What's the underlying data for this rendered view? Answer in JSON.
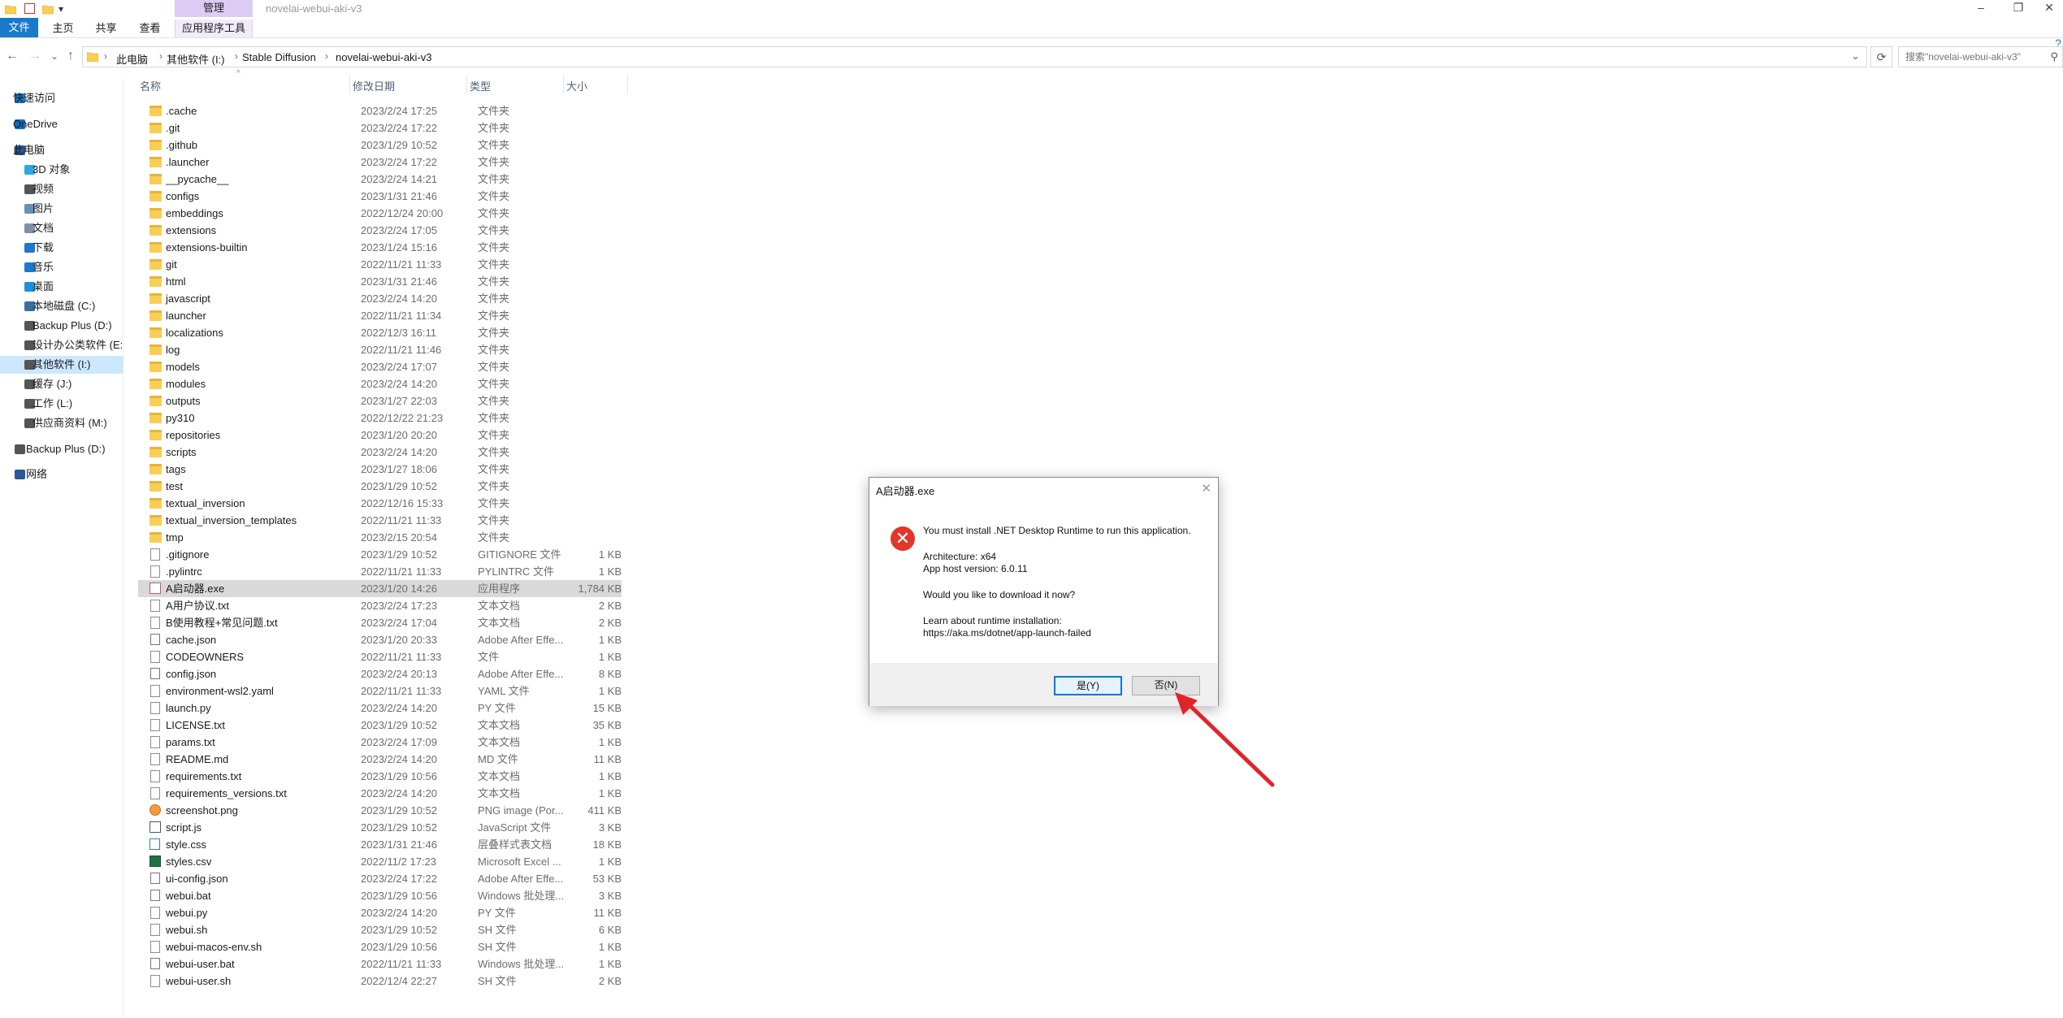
{
  "window": {
    "title": "novelai-webui-aki-v3",
    "context_tab": "管理",
    "controls": [
      "–",
      "❐",
      "✕"
    ]
  },
  "ribbon": {
    "tabs": [
      "文件",
      "主页",
      "共享",
      "查看",
      "应用程序工具"
    ],
    "help_glyph": "?"
  },
  "nav": {
    "back": "←",
    "forward": "→",
    "recent": "⌄",
    "up": "↑",
    "breadcrumb": [
      "此电脑",
      "其他软件 (I:)",
      "Stable Diffusion",
      "novelai-webui-aki-v3"
    ],
    "separator": "›",
    "dropdown": "⌄",
    "refresh": "⟳",
    "search_placeholder": "搜索\"novelai-webui-aki-v3\"",
    "search_glyph": "⚲"
  },
  "sidebar": {
    "items": [
      {
        "label": "快速访问",
        "icon": "star-icon",
        "color": "#1979ca"
      },
      {
        "label": "OneDrive",
        "icon": "cloud-icon",
        "color": "#0f6cbd"
      },
      {
        "label": "此电脑",
        "icon": "computer-icon",
        "color": "#2b5797"
      },
      {
        "label": "3D 对象",
        "icon": "cube-icon",
        "color": "#2ea8e0"
      },
      {
        "label": "视频",
        "icon": "video-icon",
        "color": "#555555"
      },
      {
        "label": "图片",
        "icon": "picture-icon",
        "color": "#6a8fb5"
      },
      {
        "label": "文档",
        "icon": "document-icon",
        "color": "#7f8fa6"
      },
      {
        "label": "下载",
        "icon": "download-icon",
        "color": "#1979ca"
      },
      {
        "label": "音乐",
        "icon": "music-icon",
        "color": "#1979ca"
      },
      {
        "label": "桌面",
        "icon": "desktop-icon",
        "color": "#1d8fe0"
      },
      {
        "label": "本地磁盘 (C:)",
        "icon": "windows-drive-icon",
        "color": "#3a6ea5"
      },
      {
        "label": "Backup Plus (D:)",
        "icon": "drive-icon",
        "color": "#555555"
      },
      {
        "label": "设计办公类软件 (E:",
        "icon": "drive-icon",
        "color": "#555555"
      },
      {
        "label": "其他软件 (I:)",
        "icon": "drive-icon",
        "color": "#555555"
      },
      {
        "label": "缓存 (J:)",
        "icon": "drive-icon",
        "color": "#555555"
      },
      {
        "label": "工作 (L:)",
        "icon": "drive-icon",
        "color": "#555555"
      },
      {
        "label": "供应商资料 (M:)",
        "icon": "drive-icon",
        "color": "#555555"
      },
      {
        "label": "Backup Plus (D:)",
        "icon": "drive-icon",
        "color": "#555555"
      },
      {
        "label": "网络",
        "icon": "network-icon",
        "color": "#2b5797"
      }
    ],
    "selected_index": 13
  },
  "columns": {
    "name": "名称",
    "date": "修改日期",
    "type": "类型",
    "size": "大小",
    "sort_glyph": "^"
  },
  "files": [
    {
      "name": ".cache",
      "date": "2023/2/24 17:25",
      "type": "文件夹",
      "size": "",
      "kind": "folder"
    },
    {
      "name": ".git",
      "date": "2023/2/24 17:22",
      "type": "文件夹",
      "size": "",
      "kind": "folder"
    },
    {
      "name": ".github",
      "date": "2023/1/29 10:52",
      "type": "文件夹",
      "size": "",
      "kind": "folder"
    },
    {
      "name": ".launcher",
      "date": "2023/2/24 17:22",
      "type": "文件夹",
      "size": "",
      "kind": "folder"
    },
    {
      "name": "__pycache__",
      "date": "2023/2/24 14:21",
      "type": "文件夹",
      "size": "",
      "kind": "folder"
    },
    {
      "name": "configs",
      "date": "2023/1/31 21:46",
      "type": "文件夹",
      "size": "",
      "kind": "folder"
    },
    {
      "name": "embeddings",
      "date": "2022/12/24 20:00",
      "type": "文件夹",
      "size": "",
      "kind": "folder"
    },
    {
      "name": "extensions",
      "date": "2023/2/24 17:05",
      "type": "文件夹",
      "size": "",
      "kind": "folder"
    },
    {
      "name": "extensions-builtin",
      "date": "2023/1/24 15:16",
      "type": "文件夹",
      "size": "",
      "kind": "folder"
    },
    {
      "name": "git",
      "date": "2022/11/21 11:33",
      "type": "文件夹",
      "size": "",
      "kind": "folder"
    },
    {
      "name": "html",
      "date": "2023/1/31 21:46",
      "type": "文件夹",
      "size": "",
      "kind": "folder"
    },
    {
      "name": "javascript",
      "date": "2023/2/24 14:20",
      "type": "文件夹",
      "size": "",
      "kind": "folder"
    },
    {
      "name": "launcher",
      "date": "2022/11/21 11:34",
      "type": "文件夹",
      "size": "",
      "kind": "folder"
    },
    {
      "name": "localizations",
      "date": "2022/12/3 16:11",
      "type": "文件夹",
      "size": "",
      "kind": "folder"
    },
    {
      "name": "log",
      "date": "2022/11/21 11:46",
      "type": "文件夹",
      "size": "",
      "kind": "folder"
    },
    {
      "name": "models",
      "date": "2023/2/24 17:07",
      "type": "文件夹",
      "size": "",
      "kind": "folder"
    },
    {
      "name": "modules",
      "date": "2023/2/24 14:20",
      "type": "文件夹",
      "size": "",
      "kind": "folder"
    },
    {
      "name": "outputs",
      "date": "2023/1/27 22:03",
      "type": "文件夹",
      "size": "",
      "kind": "folder"
    },
    {
      "name": "py310",
      "date": "2022/12/22 21:23",
      "type": "文件夹",
      "size": "",
      "kind": "folder"
    },
    {
      "name": "repositories",
      "date": "2023/1/20 20:20",
      "type": "文件夹",
      "size": "",
      "kind": "folder"
    },
    {
      "name": "scripts",
      "date": "2023/2/24 14:20",
      "type": "文件夹",
      "size": "",
      "kind": "folder"
    },
    {
      "name": "tags",
      "date": "2023/1/27 18:06",
      "type": "文件夹",
      "size": "",
      "kind": "folder"
    },
    {
      "name": "test",
      "date": "2023/1/29 10:52",
      "type": "文件夹",
      "size": "",
      "kind": "folder"
    },
    {
      "name": "textual_inversion",
      "date": "2022/12/16 15:33",
      "type": "文件夹",
      "size": "",
      "kind": "folder"
    },
    {
      "name": "textual_inversion_templates",
      "date": "2022/11/21 11:33",
      "type": "文件夹",
      "size": "",
      "kind": "folder"
    },
    {
      "name": "tmp",
      "date": "2023/2/15 20:54",
      "type": "文件夹",
      "size": "",
      "kind": "folder"
    },
    {
      "name": ".gitignore",
      "date": "2023/1/29 10:52",
      "type": "GITIGNORE 文件",
      "size": "1 KB",
      "kind": "file"
    },
    {
      "name": ".pylintrc",
      "date": "2022/11/21 11:33",
      "type": "PYLINTRC 文件",
      "size": "1 KB",
      "kind": "file"
    },
    {
      "name": "A启动器.exe",
      "date": "2023/1/20 14:26",
      "type": "应用程序",
      "size": "1,784 KB",
      "kind": "exe"
    },
    {
      "name": "A用户协议.txt",
      "date": "2023/2/24 17:23",
      "type": "文本文档",
      "size": "2 KB",
      "kind": "file"
    },
    {
      "name": "B使用教程+常见问题.txt",
      "date": "2023/2/24 17:04",
      "type": "文本文档",
      "size": "2 KB",
      "kind": "file"
    },
    {
      "name": "cache.json",
      "date": "2023/1/20 20:33",
      "type": "Adobe After Effe...",
      "size": "1 KB",
      "kind": "gear"
    },
    {
      "name": "CODEOWNERS",
      "date": "2022/11/21 11:33",
      "type": "文件",
      "size": "1 KB",
      "kind": "file"
    },
    {
      "name": "config.json",
      "date": "2023/2/24 20:13",
      "type": "Adobe After Effe...",
      "size": "8 KB",
      "kind": "gear"
    },
    {
      "name": "environment-wsl2.yaml",
      "date": "2022/11/21 11:33",
      "type": "YAML 文件",
      "size": "1 KB",
      "kind": "file"
    },
    {
      "name": "launch.py",
      "date": "2023/2/24 14:20",
      "type": "PY 文件",
      "size": "15 KB",
      "kind": "file"
    },
    {
      "name": "LICENSE.txt",
      "date": "2023/1/29 10:52",
      "type": "文本文档",
      "size": "35 KB",
      "kind": "file"
    },
    {
      "name": "params.txt",
      "date": "2023/2/24 17:09",
      "type": "文本文档",
      "size": "1 KB",
      "kind": "file"
    },
    {
      "name": "README.md",
      "date": "2023/2/24 14:20",
      "type": "MD 文件",
      "size": "11 KB",
      "kind": "file"
    },
    {
      "name": "requirements.txt",
      "date": "2023/1/29 10:56",
      "type": "文本文档",
      "size": "1 KB",
      "kind": "file"
    },
    {
      "name": "requirements_versions.txt",
      "date": "2023/2/24 14:20",
      "type": "文本文档",
      "size": "1 KB",
      "kind": "file"
    },
    {
      "name": "screenshot.png",
      "date": "2023/1/29 10:52",
      "type": "PNG image (Por...",
      "size": "411 KB",
      "kind": "img"
    },
    {
      "name": "script.js",
      "date": "2023/1/29 10:52",
      "type": "JavaScript 文件",
      "size": "3 KB",
      "kind": "js"
    },
    {
      "name": "style.css",
      "date": "2023/1/31 21:46",
      "type": "层叠样式表文档",
      "size": "18 KB",
      "kind": "css"
    },
    {
      "name": "styles.csv",
      "date": "2022/11/2 17:23",
      "type": "Microsoft Excel ...",
      "size": "1 KB",
      "kind": "xls"
    },
    {
      "name": "ui-config.json",
      "date": "2023/2/24 17:22",
      "type": "Adobe After Effe...",
      "size": "53 KB",
      "kind": "gear"
    },
    {
      "name": "webui.bat",
      "date": "2023/1/29 10:56",
      "type": "Windows 批处理...",
      "size": "3 KB",
      "kind": "gear"
    },
    {
      "name": "webui.py",
      "date": "2023/2/24 14:20",
      "type": "PY 文件",
      "size": "11 KB",
      "kind": "file"
    },
    {
      "name": "webui.sh",
      "date": "2023/1/29 10:52",
      "type": "SH 文件",
      "size": "6 KB",
      "kind": "file"
    },
    {
      "name": "webui-macos-env.sh",
      "date": "2023/1/29 10:56",
      "type": "SH 文件",
      "size": "1 KB",
      "kind": "file"
    },
    {
      "name": "webui-user.bat",
      "date": "2022/11/21 11:33",
      "type": "Windows 批处理...",
      "size": "1 KB",
      "kind": "gear"
    },
    {
      "name": "webui-user.sh",
      "date": "2022/12/4 22:27",
      "type": "SH 文件",
      "size": "2 KB",
      "kind": "file"
    }
  ],
  "selected_file_index": 28,
  "dialog": {
    "title": "A启动器.exe",
    "close": "✕",
    "error_glyph": "✕",
    "message": "You must install .NET Desktop Runtime to run this application.",
    "architecture": "Architecture: x64",
    "host_version": "App host version: 6.0.11",
    "question": "Would you like to download it now?",
    "learn": "Learn about runtime installation:",
    "link": "https://aka.ms/dotnet/app-launch-failed",
    "yes_label": "是(Y)",
    "no_label": "否(N)"
  },
  "annotation": {
    "arrow_color": "#e1242b"
  }
}
